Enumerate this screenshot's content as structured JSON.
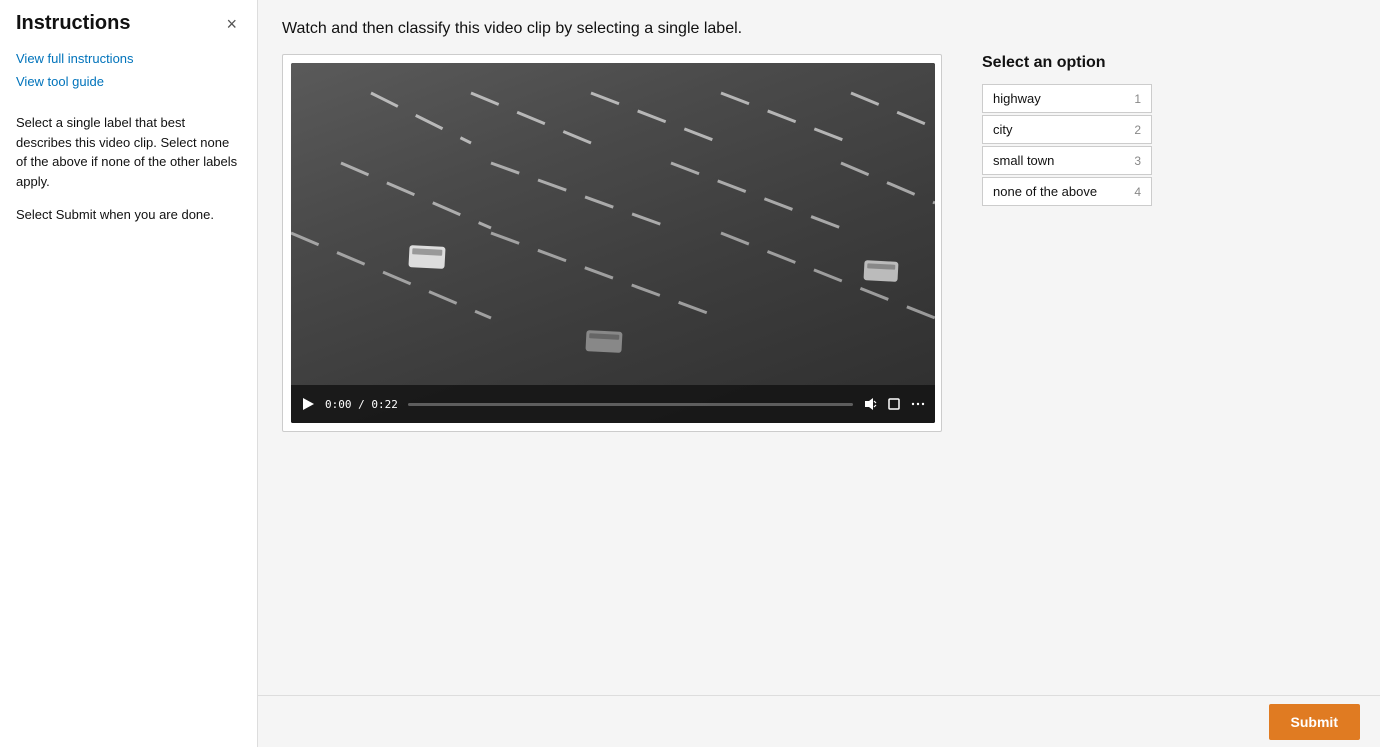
{
  "sidebar": {
    "title": "Instructions",
    "close_label": "×",
    "view_full_instructions": "View full instructions",
    "view_tool_guide": "View tool guide",
    "paragraph1": "Select a single label that best describes this video clip. Select none of the above if none of the other labels apply.",
    "paragraph2": "Select Submit when you are done."
  },
  "main": {
    "instruction_text": "Watch and then classify this video clip by selecting a single label.",
    "video": {
      "time_current": "0:00",
      "time_total": "0:22",
      "time_display": "0:00 / 0:22"
    }
  },
  "options": {
    "title": "Select an option",
    "items": [
      {
        "label": "highway",
        "number": "1"
      },
      {
        "label": "city",
        "number": "2"
      },
      {
        "label": "small town",
        "number": "3"
      },
      {
        "label": "none of the above",
        "number": "4"
      }
    ]
  },
  "toolbar": {
    "submit_label": "Submit"
  }
}
